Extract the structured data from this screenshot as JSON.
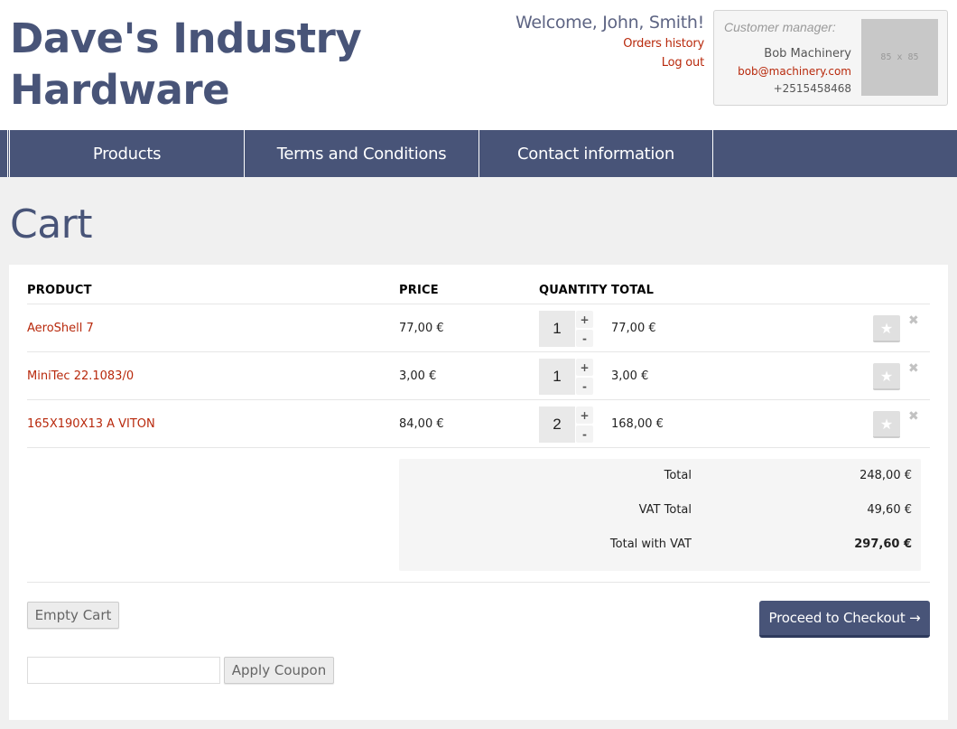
{
  "site": {
    "title_line1": "Dave's Industry",
    "title_line2": "Hardware"
  },
  "user": {
    "welcome": "Welcome, John, Smith!",
    "orders_history": "Orders history",
    "log_out": "Log out"
  },
  "manager": {
    "label": "Customer manager:",
    "name": "Bob Machinery",
    "email": "bob@machinery.com",
    "phone": "+2515458468",
    "photo_placeholder": "85 x 85"
  },
  "nav": {
    "items": [
      {
        "label": "Products"
      },
      {
        "label": "Terms and Conditions"
      },
      {
        "label": "Contact information"
      }
    ]
  },
  "page": {
    "title": "Cart"
  },
  "cart": {
    "columns": {
      "product": "PRODUCT",
      "price": "PRICE",
      "quantity": "QUANTITY",
      "total": "TOTAL"
    },
    "rows": [
      {
        "product": "AeroShell 7",
        "price": "77,00 €",
        "quantity": "1",
        "total": "77,00 €"
      },
      {
        "product": "MiniTec 22.1083/0",
        "price": "3,00 €",
        "quantity": "1",
        "total": "3,00 €"
      },
      {
        "product": "165X190X13 A VITON",
        "price": "84,00 €",
        "quantity": "2",
        "total": "168,00 €"
      }
    ],
    "increment_symbol": "+",
    "decrement_symbol": "-",
    "favorite_icon": "★",
    "remove_icon": "✖",
    "totals": {
      "total_label": "Total",
      "total_value": "248,00 €",
      "vat_label": "VAT Total",
      "vat_value": "49,60 €",
      "grand_label": "Total with VAT",
      "grand_value": "297,60 €"
    },
    "empty_cart": "Empty Cart",
    "checkout": "Proceed to Checkout →",
    "coupon": {
      "value": "",
      "placeholder": "",
      "apply": "Apply Coupon"
    }
  },
  "colors": {
    "brand": "#485478",
    "link": "#b8290c",
    "background": "#f0f0f0"
  }
}
